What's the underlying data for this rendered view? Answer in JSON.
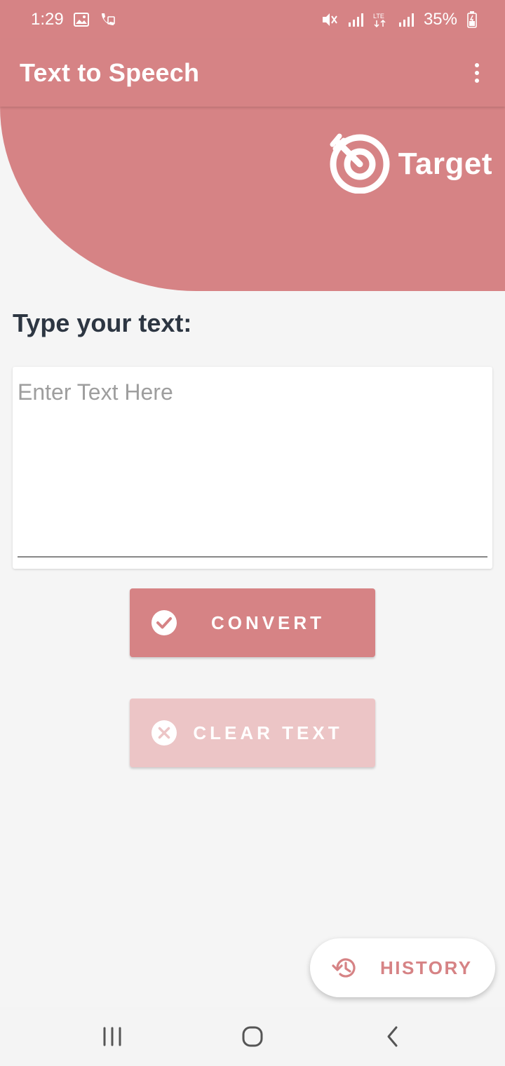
{
  "status_bar": {
    "time": "1:29",
    "battery": "35%",
    "icons": [
      "gallery-icon",
      "wifi-call-icon",
      "mute-icon",
      "signal-icon",
      "lte-icon",
      "signal-icon",
      "battery-icon"
    ]
  },
  "app_bar": {
    "title": "Text to Speech",
    "menu_icon": "more-vert-icon"
  },
  "logo": {
    "text": "Target",
    "icon": "target-icon"
  },
  "prompt": "Type your text:",
  "text_input": {
    "value": "",
    "placeholder": "Enter Text Here"
  },
  "buttons": {
    "convert": {
      "label": "CONVERT",
      "icon": "check-circle-icon"
    },
    "clear": {
      "label": "CLEAR TEXT",
      "icon": "x-circle-icon"
    }
  },
  "fab": {
    "label": "HISTORY",
    "icon": "history-icon"
  },
  "nav_bar": [
    "recents-icon",
    "home-icon",
    "back-icon"
  ],
  "colors": {
    "accent": "#d68385",
    "accent_light": "#ecc5c6",
    "background": "#f5f5f5",
    "prompt_text": "#2d3642"
  }
}
